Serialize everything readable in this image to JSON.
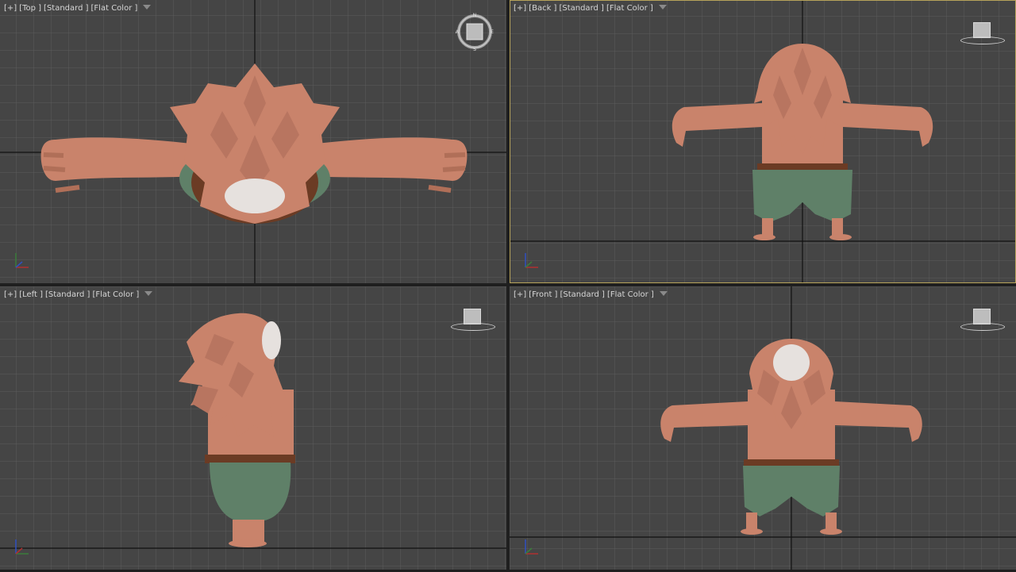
{
  "viewports": {
    "top": {
      "plus": "[+]",
      "view": "[Top ]",
      "shading": "[Standard ]",
      "mode": "[Flat Color ]"
    },
    "back": {
      "plus": "[+]",
      "view": "[Back ]",
      "shading": "[Standard ]",
      "mode": "[Flat Color ]"
    },
    "left": {
      "plus": "[+]",
      "view": "[Left ]",
      "shading": "[Standard ]",
      "mode": "[Flat Color ]"
    },
    "front": {
      "plus": "[+]",
      "view": "[Front ]",
      "shading": "[Standard ]",
      "mode": "[Flat Color ]"
    }
  },
  "compass": {
    "n": "N",
    "s": "S",
    "e": "E",
    "w": "W"
  },
  "active_viewport": "back",
  "colors": {
    "viewport_bg": "#454545",
    "grid_line": "#595959",
    "grid_major": "#111111",
    "active_border": "#b7a35a",
    "skin": "#c9836b",
    "pants": "#5f8068",
    "belt": "#6b3b24"
  }
}
